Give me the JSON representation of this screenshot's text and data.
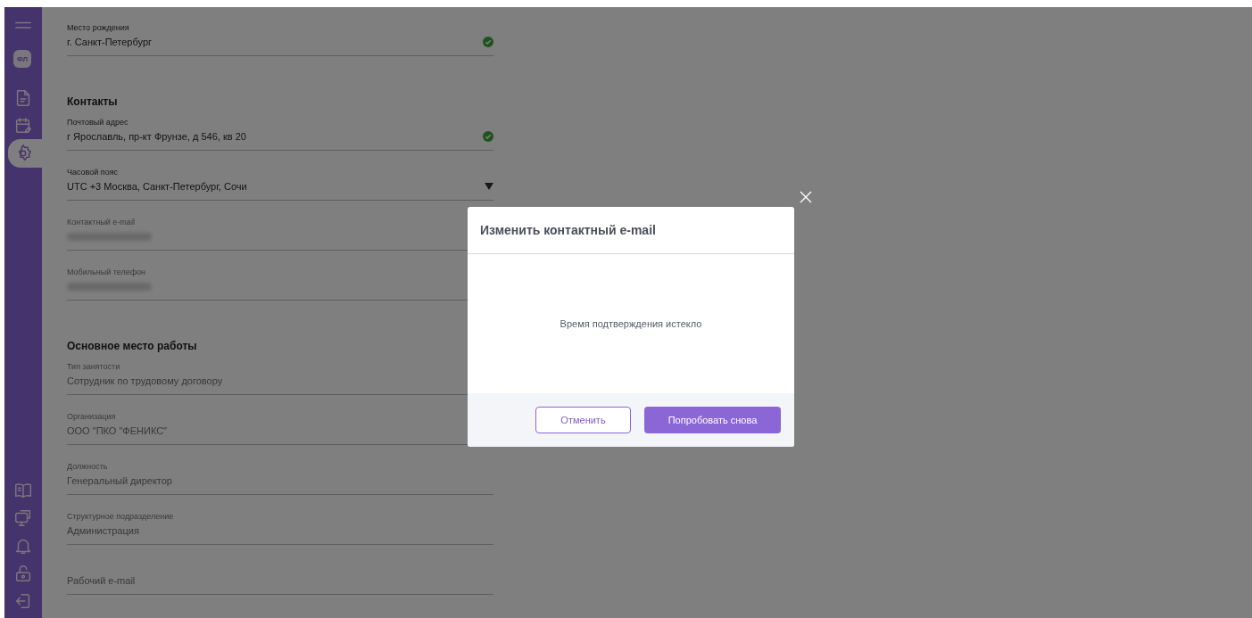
{
  "sidebar": {
    "top_items": [
      {
        "kind": "menu",
        "selected": false
      },
      {
        "kind": "badge",
        "label": "ФЛ",
        "selected": false
      },
      {
        "kind": "document",
        "selected": false
      },
      {
        "kind": "calendar",
        "selected": false
      },
      {
        "kind": "settings",
        "selected": true
      }
    ],
    "bottom_items": [
      {
        "kind": "book"
      },
      {
        "kind": "monitor"
      },
      {
        "kind": "bell"
      },
      {
        "kind": "lock"
      },
      {
        "kind": "logout"
      }
    ]
  },
  "form": [
    {
      "kind": "field",
      "label": "Место рождения",
      "value": "г. Санкт-Петербург",
      "verified": true,
      "disabled": false
    },
    {
      "kind": "heading",
      "text": "Контакты"
    },
    {
      "kind": "field",
      "label": "Почтовый адрес",
      "value": "г Ярославль, пр-кт Фрунзе, д 546, кв 20",
      "verified": true,
      "disabled": false
    },
    {
      "kind": "select",
      "label": "Часовой пояс",
      "value": "UTC +3 Москва, Санкт-Петербург, Сочи",
      "disabled": false
    },
    {
      "kind": "field",
      "label": "Контактный e-mail",
      "masked": true,
      "disabled": true
    },
    {
      "kind": "field",
      "label": "Мобильный телефон",
      "masked": true,
      "disabled": true
    },
    {
      "kind": "heading",
      "text": "Основное место работы"
    },
    {
      "kind": "field",
      "label": "Тип занятости",
      "value": "Сотрудник по трудовому договору",
      "disabled": true
    },
    {
      "kind": "field",
      "label": "Организация",
      "value": "ООО \"ПКО \"ФЕНИКС\"",
      "disabled": true
    },
    {
      "kind": "field",
      "label": "Должность",
      "value": "Генеральный директор",
      "disabled": true
    },
    {
      "kind": "field",
      "label": "Структурное подразделение",
      "value": "Администрация",
      "disabled": true
    },
    {
      "kind": "input",
      "placeholder": "Рабочий e-mail",
      "disabled": true
    }
  ],
  "dialog": {
    "title": "Изменить контактный e-mail",
    "message": "Время подтверждения истекло",
    "buttons": [
      {
        "label": "Отменить",
        "kind": "secondary"
      },
      {
        "label": "Попробовать снова",
        "kind": "primary"
      }
    ]
  }
}
